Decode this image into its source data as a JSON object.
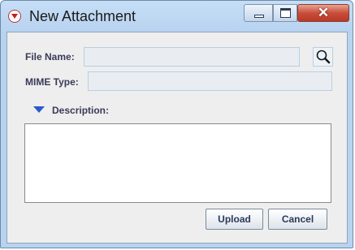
{
  "window": {
    "title": "New Attachment"
  },
  "form": {
    "file_name_label": "File Name:",
    "file_name_value": "",
    "mime_type_label": "MIME Type:",
    "mime_type_value": "",
    "description_label": "Description:",
    "description_value": ""
  },
  "buttons": {
    "upload": "Upload",
    "cancel": "Cancel"
  },
  "icons": {
    "app": "app-icon",
    "search": "magnifier-icon",
    "collapse": "triangle-down-icon"
  },
  "colors": {
    "titlebar": "#c6def6",
    "close_button": "#c94e3a",
    "disclosure_arrow": "#2a5ad0"
  }
}
